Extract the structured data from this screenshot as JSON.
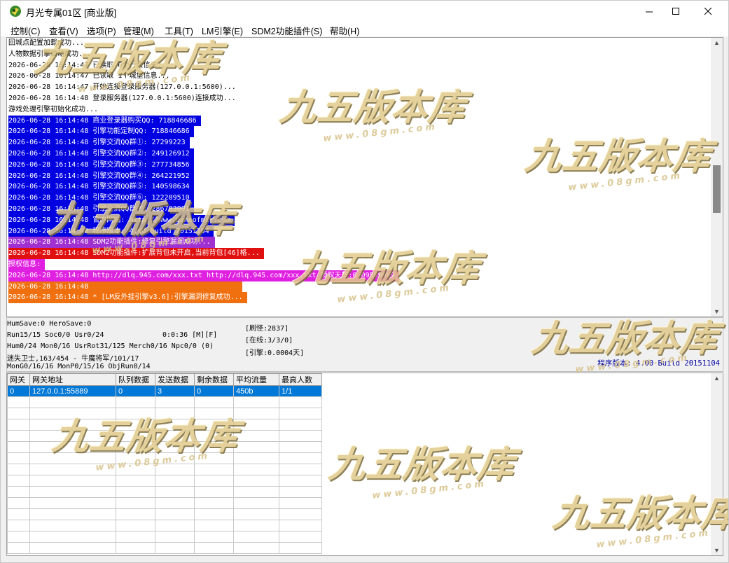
{
  "window": {
    "title": "月光专属01区 [商业版]"
  },
  "menu": [
    "控制(C)",
    "查看(V)",
    "选项(P)",
    "管理(M)",
    "工具(T)",
    "LM引擎(E)",
    "SDM2功能插件(S)",
    "帮助(H)"
  ],
  "log": [
    {
      "text": "回城点配置加载成功...",
      "bg": "#ffffff",
      "fg": "#000000"
    },
    {
      "text": "人物数据引擎启动成功...",
      "bg": "#ffffff",
      "fg": "#000000"
    },
    {
      "text": "2026-06-28 16:14:47 已读取 0个行会信息...",
      "bg": "#ffffff",
      "fg": "#000000"
    },
    {
      "text": "2026-06-28 16:14:47 已读取 1个城堡信息...",
      "bg": "#ffffff",
      "fg": "#000000"
    },
    {
      "text": "2026-06-28 16:14:47 开始连接登录服务器(127.0.0.1:5600)...",
      "bg": "#ffffff",
      "fg": "#000000"
    },
    {
      "text": "2026-06-28 16:14:48 登录服务器(127.0.0.1:5600)连接成功...",
      "bg": "#ffffff",
      "fg": "#000000"
    },
    {
      "text": "游戏处理引擎初始化成功...",
      "bg": "#ffffff",
      "fg": "#000000"
    },
    {
      "text": "2026-06-28 16:14:48 商业登录器购买QQ: 718846686",
      "bg": "#0000e0",
      "fg": "#ffffff"
    },
    {
      "text": "2026-06-28 16:14:48 引擎功能定制QQ: 718846686",
      "bg": "#0000e0",
      "fg": "#ffffff"
    },
    {
      "text": "2026-06-28 16:14:48 引擎交流QQ群①: 27299223",
      "bg": "#0000e0",
      "fg": "#ffffff"
    },
    {
      "text": "2026-06-28 16:14:48 引擎交流QQ群②: 249126912",
      "bg": "#0000e0",
      "fg": "#ffffff"
    },
    {
      "text": "2026-06-28 16:14:48 引擎交流QQ群③: 277734856",
      "bg": "#0000e0",
      "fg": "#ffffff"
    },
    {
      "text": "2026-06-28 16:14:48 引擎交流QQ群④: 264221952",
      "bg": "#0000e0",
      "fg": "#ffffff"
    },
    {
      "text": "2026-06-28 16:14:48 引擎交流QQ群⑤: 140598634",
      "bg": "#0000e0",
      "fg": "#ffffff"
    },
    {
      "text": "2026-06-28 16:14:48 引擎交流QQ群⑥: 122209510",
      "bg": "#0000e0",
      "fg": "#ffffff"
    },
    {
      "text": "2026-06-28 16:14:48 引擎交流QQ群⑦: 286703001",
      "bg": "#0000e0",
      "fg": "#ffffff"
    },
    {
      "text": "2026-06-28 16:14:48 官方网站: http://www.gameofmir.com",
      "bg": "#0000e0",
      "fg": "#ffffff"
    },
    {
      "text": "2026-06-28 16:14:48 程序版本: 4.00 Build 20151104",
      "bg": "#0000e0",
      "fg": "#ffffff"
    },
    {
      "text": "2026-06-28 16:14:48 SDM2功能插件:修复引擎漏洞成功...",
      "bg": "#a030d0",
      "fg": "#ffffff"
    },
    {
      "text": "2026-06-28 16:14:48 SDM2功能插件:扩展背包未开启,当前背包[46]格...",
      "bg": "#e01010",
      "fg": "#ffffff"
    },
    {
      "text": "授权信息:",
      "bg": "#e020e0",
      "fg": "#ffffff"
    },
    {
      "text": "2026-06-28 16:14:48 http://dlq.945.com/xxx.txt http://dlq.945.com/xxx.txt 授权天数:0.09599999",
      "bg": "#e020e0",
      "fg": "#ffffff"
    },
    {
      "text": "2026-06-28 16:14:48",
      "bg": "#f07010",
      "fg": "#ffffff",
      "pad": 220
    },
    {
      "text": "2026-06-28 16:14:48 * [LM反外挂引擎v3.6]:引擎漏洞修复成功...",
      "bg": "#f07010",
      "fg": "#ffffff"
    }
  ],
  "status": {
    "line1": "HumSave:0 HeroSave:0",
    "line2": "Run15/15 Soc0/0 Usr0/24",
    "time": "0:0:36 [M][F]",
    "line3": "Hum0/24 Mon0/16 UsrRot31/125 Merch0/16 Npc0/0 (0)",
    "line4": "迷失卫士,163/454 - 牛魔将军/101/17",
    "line5": "MonG0/16/16 MonP0/15/16 ObjRun0/14",
    "refresh": "[刷怪:2837]",
    "online": "[在线:3/3/0]",
    "engine": "[引擎:0.0004天]",
    "version": "程序版本: 4.00 Build 20151104"
  },
  "gateway": {
    "columns": [
      "网关",
      "网关地址",
      "队列数据",
      "发送数据",
      "剩余数据",
      "平均流量",
      "最高人数"
    ],
    "rows": [
      [
        "0",
        "127.0.0.1:55889",
        "0",
        "3",
        "0",
        "450b",
        "1/1"
      ]
    ]
  },
  "watermark": {
    "text": "九五版本库",
    "url": "www.08gm.com"
  }
}
